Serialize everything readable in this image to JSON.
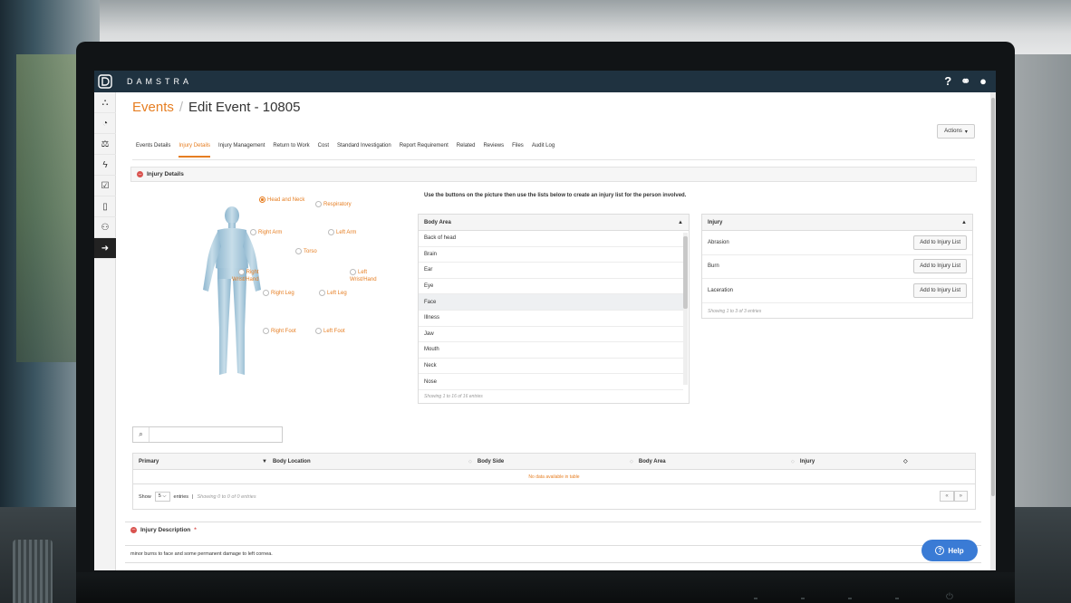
{
  "app": {
    "brand": "DAMSTRA"
  },
  "header": {
    "breadcrumb_root": "Events",
    "separator": "/",
    "page_title": "Edit Event - 10805",
    "actions_label": "Actions"
  },
  "sidebar": {
    "items": [
      {
        "icon": "sitemap-icon"
      },
      {
        "icon": "dashboard-icon"
      },
      {
        "icon": "scales-icon"
      },
      {
        "icon": "lightning-icon"
      },
      {
        "icon": "checklist-icon"
      },
      {
        "icon": "document-icon"
      },
      {
        "icon": "users-icon"
      },
      {
        "icon": "arrow-right-icon"
      }
    ]
  },
  "tabs": [
    {
      "label": "Events Details"
    },
    {
      "label": "Injury Details"
    },
    {
      "label": "Injury Management"
    },
    {
      "label": "Return to Work"
    },
    {
      "label": "Cost"
    },
    {
      "label": "Standard Investigation"
    },
    {
      "label": "Report Requirement"
    },
    {
      "label": "Related"
    },
    {
      "label": "Reviews"
    },
    {
      "label": "Files"
    },
    {
      "label": "Audit Log"
    }
  ],
  "injury_details": {
    "section_title": "Injury Details",
    "instructions": "Use the buttons on the picture then use the lists below to create an injury list for the person involved.",
    "body_labels": {
      "head_and_neck": "Head and Neck",
      "respiratory": "Respiratory",
      "right_arm": "Right Arm",
      "left_arm": "Left Arm",
      "torso": "Torso",
      "right_wrist_line1": "Right",
      "right_wrist_line2": "Wrist/Hand",
      "left_wrist_line1": "Left",
      "left_wrist_line2": "Wrist/Hand",
      "right_leg": "Right Leg",
      "left_leg": "Left Leg",
      "right_foot": "Right Foot",
      "left_foot": "Left Foot"
    },
    "body_area_table": {
      "header": "Body Area",
      "rows": [
        "Back of head",
        "Brain",
        "Ear",
        "Eye",
        "Face",
        "Illness",
        "Jaw",
        "Mouth",
        "Neck",
        "Nose"
      ],
      "footer": "Showing 1 to 16 of 16 entries"
    },
    "injury_table": {
      "header": "Injury",
      "rows": [
        {
          "name": "Abrasion",
          "button": "Add to Injury List"
        },
        {
          "name": "Burn",
          "button": "Add to Injury List"
        },
        {
          "name": "Laceration",
          "button": "Add to Injury List"
        }
      ],
      "footer": "Showing 1 to 3 of 3 entries"
    }
  },
  "injury_list": {
    "search_value": "",
    "columns": {
      "primary": "Primary",
      "body_location": "Body Location",
      "body_side": "Body Side",
      "body_area": "Body Area",
      "injury": "Injury"
    },
    "empty_text": "No data available in table",
    "show_label": "Show",
    "page_size": "5",
    "entries_label": "entries",
    "divider": "|",
    "info": "Showing 0 to 0 of 0 entries",
    "pager_first": "«",
    "pager_last": "»"
  },
  "description": {
    "title": "Injury Description",
    "required_mark": "*",
    "text": "minor burns to face and some permanent damage to left cornea."
  },
  "help": {
    "label": "Help"
  },
  "colors": {
    "accent": "#e67e22",
    "topbar": "#1f3240",
    "help": "#3a7bd5",
    "danger": "#d9534f"
  }
}
